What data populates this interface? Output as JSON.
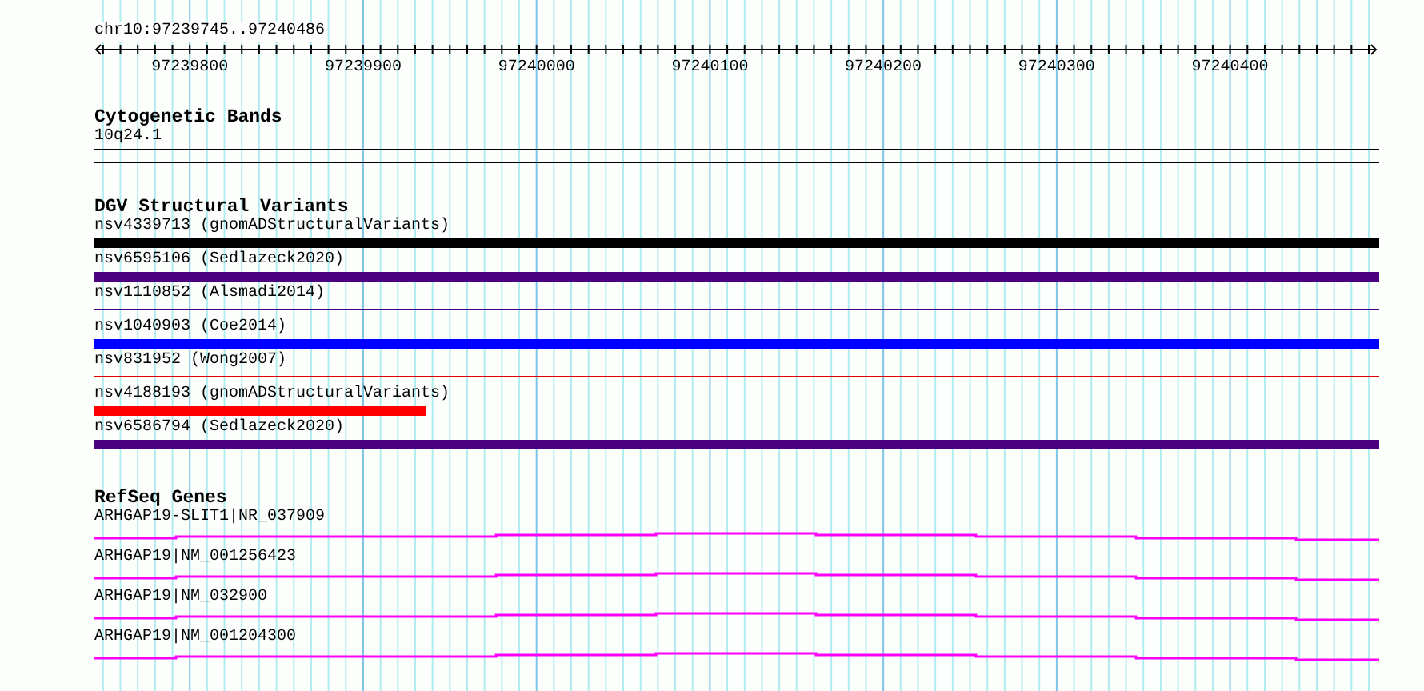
{
  "ruler": {
    "location": "chr10:97239745..97240486",
    "ticks": [
      "97239800",
      "97239900",
      "97240000",
      "97240100",
      "97240200",
      "97240300",
      "97240400"
    ]
  },
  "tracks": [
    {
      "title": "Cytogenetic Bands",
      "kind": "bands",
      "features": [
        {
          "label": "10q24.1"
        }
      ]
    },
    {
      "title": "DGV Structural Variants",
      "kind": "variants",
      "features": [
        {
          "label": "nsv4339713 (gnomADStructuralVariants)",
          "kind": "thick",
          "color": "#000000"
        },
        {
          "label": "nsv6595106 (Sedlazeck2020)",
          "kind": "thick",
          "color": "#4b0082"
        },
        {
          "label": "nsv1110852 (Alsmadi2014)",
          "kind": "thin",
          "color": "#4b0082"
        },
        {
          "label": "nsv1040903 (Coe2014)",
          "kind": "thick",
          "color": "#0000ff"
        },
        {
          "label": "nsv831952 (Wong2007)",
          "kind": "thin",
          "color": "#e00000"
        },
        {
          "label": "nsv4188193 (gnomADStructuralVariants)",
          "kind": "short",
          "color": "#ff0000"
        },
        {
          "label": "nsv6586794 (Sedlazeck2020)",
          "kind": "thick",
          "color": "#4b0082"
        }
      ]
    },
    {
      "title": "RefSeq Genes",
      "kind": "genes",
      "features": [
        {
          "label": "ARHGAP19-SLIT1|NR_037909"
        },
        {
          "label": "ARHGAP19|NM_001256423"
        },
        {
          "label": "ARHGAP19|NM_032900"
        },
        {
          "label": "ARHGAP19|NM_001204300"
        }
      ]
    }
  ]
}
